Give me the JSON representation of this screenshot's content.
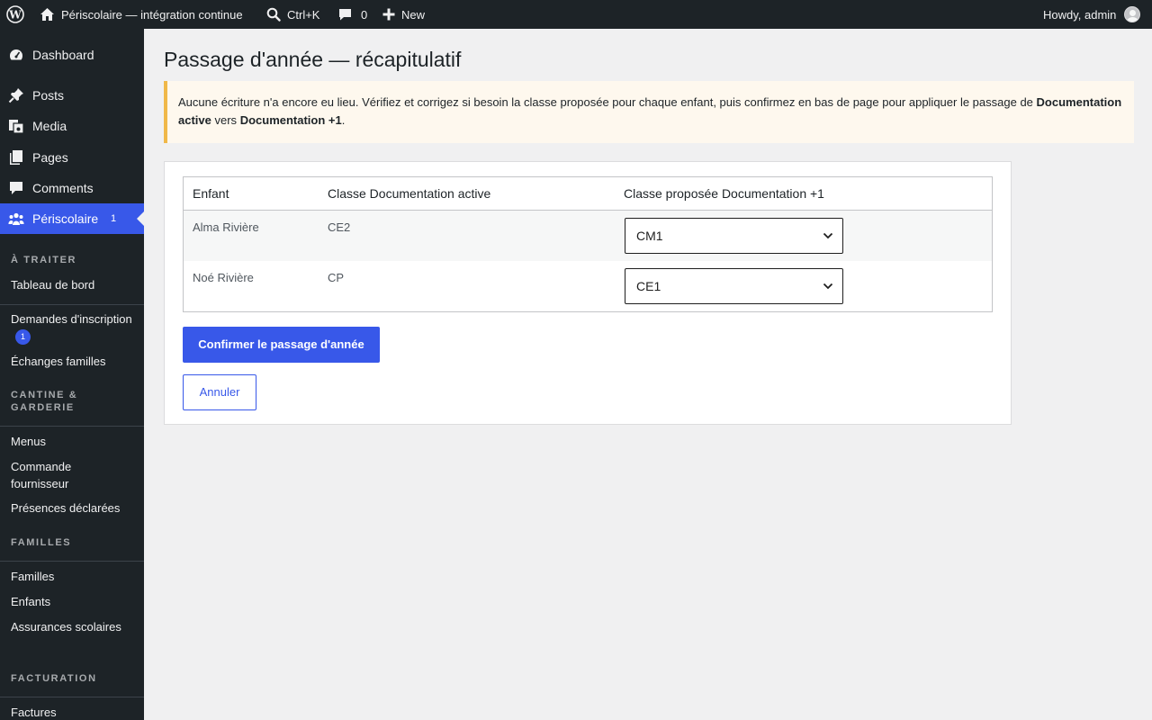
{
  "admin_bar": {
    "site_name": "Périscolaire — intégration continue",
    "search_shortcut": "Ctrl+K",
    "comments_count": "0",
    "new_label": "New",
    "howdy": "Howdy, admin"
  },
  "sidebar": {
    "top_items": [
      {
        "label": "Dashboard",
        "icon": "dashboard-icon"
      },
      {
        "label": "Posts",
        "icon": "pin-icon"
      },
      {
        "label": "Media",
        "icon": "media-icon"
      },
      {
        "label": "Pages",
        "icon": "pages-icon"
      },
      {
        "label": "Comments",
        "icon": "comment-icon"
      }
    ],
    "current": {
      "label": "Périscolaire",
      "count": "1",
      "icon": "groups-icon"
    },
    "sections": {
      "a_traiter": "À TRAITER",
      "cantine": "CANTINE & GARDERIE",
      "familles": "FAMILLES",
      "facturation": "FACTURATION"
    },
    "items": {
      "tableau_de_bord": "Tableau de bord",
      "demandes": "Demandes d'inscription",
      "demandes_count": "1",
      "echanges": "Échanges familles",
      "menus": "Menus",
      "commande": "Commande fournisseur",
      "presences": "Présences déclarées",
      "familles": "Familles",
      "enfants": "Enfants",
      "assurances": "Assurances scolaires",
      "factures": "Factures"
    }
  },
  "main": {
    "title": "Passage d'année — récapitulatif",
    "notice": {
      "text_before": "Aucune écriture n'a encore eu lieu. Vérifiez et corrigez si besoin la classe proposée pour chaque enfant, puis confirmez en bas de page pour appliquer le passage de",
      "from": "Documentation active",
      "middle": "vers",
      "to": "Documentation +1",
      "end": "."
    },
    "table": {
      "headers": [
        "Enfant",
        "Classe Documentation active",
        "Classe proposée Documentation +1"
      ],
      "rows": [
        {
          "child": "Alma Rivière",
          "current_class": "CE2",
          "proposed_class": "CM1"
        },
        {
          "child": "Noé Rivière",
          "current_class": "CP",
          "proposed_class": "CE1"
        }
      ]
    },
    "confirm_button": "Confirmer le passage d'année",
    "cancel_button": "Annuler"
  },
  "colors": {
    "admin_bg": "#1d2327",
    "accent": "#3858e9",
    "notice_border": "#f0b849",
    "notice_bg": "#fef8ee"
  }
}
